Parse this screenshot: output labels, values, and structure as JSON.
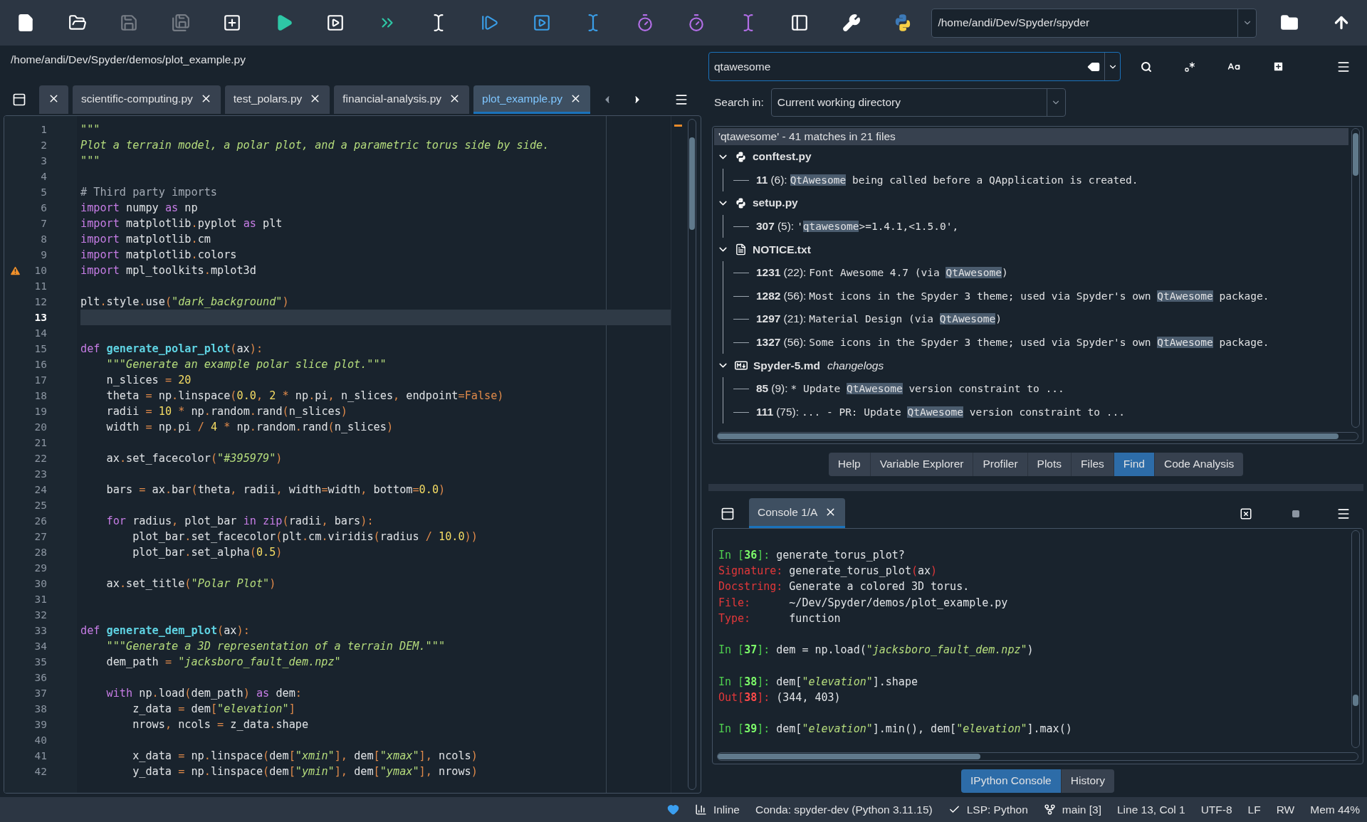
{
  "toolbar": [
    {
      "disabled": false
    },
    {
      "disabled": false
    },
    {
      "disabled": true
    },
    {
      "disabled": true
    },
    {
      "disabled": false
    },
    {
      "disabled": false
    },
    {
      "disabled": false
    },
    {
      "disabled": false
    },
    {
      "disabled": false
    },
    {
      "disabled": false
    },
    {
      "disabled": false
    },
    {
      "disabled": false
    },
    {
      "disabled": false
    },
    {
      "disabled": false
    },
    {
      "disabled": false
    },
    {
      "disabled": false
    },
    {
      "disabled": false
    },
    {
      "disabled": false
    }
  ],
  "working_directory": "/home/andi/Dev/Spyder/spyder",
  "editor": {
    "path": "/home/andi/Dev/Spyder/demos/plot_example.py",
    "tabs": [
      {
        "selected": false
      },
      {
        "label": "scientific-computing.py",
        "selected": false
      },
      {
        "label": "test_polars.py",
        "selected": false
      },
      {
        "label": "financial-analysis.py",
        "selected": false
      },
      {
        "label": "plot_example.py",
        "selected": true
      }
    ],
    "lines": [
      {
        "n": "1",
        "current": false,
        "warning": false,
        "tokens": [
          {
            "kind": "string",
            "text": "\"\"\""
          }
        ]
      },
      {
        "n": "2",
        "current": false,
        "warning": false,
        "tokens": [
          {
            "kind": "string",
            "text": "Plot a terrain model, a polar plot, and a parametric torus side by side."
          }
        ]
      },
      {
        "n": "3",
        "current": false,
        "warning": false,
        "tokens": [
          {
            "kind": "string",
            "text": "\"\"\""
          }
        ]
      },
      {
        "n": "4",
        "current": false,
        "warning": false
      },
      {
        "n": "5",
        "current": false,
        "warning": false,
        "tokens": [
          {
            "kind": "comment",
            "text": "# Third party imports"
          }
        ]
      },
      {
        "n": "6",
        "current": false,
        "warning": false,
        "tokens": [
          {
            "kind": "keyword",
            "text": "import"
          },
          {
            "kind": "plain",
            "text": " numpy "
          },
          {
            "kind": "keyword",
            "text": "as"
          },
          {
            "kind": "plain",
            "text": " np"
          }
        ]
      },
      {
        "n": "7",
        "current": false,
        "warning": false,
        "tokens": [
          {
            "kind": "keyword",
            "text": "import"
          },
          {
            "kind": "plain",
            "text": " matplotlib"
          },
          {
            "kind": "operator",
            "text": "."
          },
          {
            "kind": "plain",
            "text": "pyplot "
          },
          {
            "kind": "keyword",
            "text": "as"
          },
          {
            "kind": "plain",
            "text": " plt"
          }
        ]
      },
      {
        "n": "8",
        "current": false,
        "warning": false,
        "tokens": [
          {
            "kind": "keyword",
            "text": "import"
          },
          {
            "kind": "plain",
            "text": " matplotlib"
          },
          {
            "kind": "operator",
            "text": "."
          },
          {
            "kind": "plain",
            "text": "cm"
          }
        ]
      },
      {
        "n": "9",
        "current": false,
        "warning": false,
        "tokens": [
          {
            "kind": "keyword",
            "text": "import"
          },
          {
            "kind": "plain",
            "text": " matplotlib"
          },
          {
            "kind": "operator",
            "text": "."
          },
          {
            "kind": "plain",
            "text": "colors"
          }
        ]
      },
      {
        "n": "10",
        "current": false,
        "warning": true,
        "tokens": [
          {
            "kind": "keyword",
            "text": "import"
          },
          {
            "kind": "plain",
            "text": " mpl_toolkits"
          },
          {
            "kind": "operator",
            "text": "."
          },
          {
            "kind": "plain",
            "text": "mplot3d"
          }
        ]
      },
      {
        "n": "11",
        "current": false,
        "warning": false
      },
      {
        "n": "12",
        "current": false,
        "warning": false,
        "tokens": [
          {
            "kind": "plain",
            "text": "plt"
          },
          {
            "kind": "operator",
            "text": "."
          },
          {
            "kind": "plain",
            "text": "style"
          },
          {
            "kind": "operator",
            "text": "."
          },
          {
            "kind": "plain",
            "text": "use"
          },
          {
            "kind": "operator",
            "text": "("
          },
          {
            "kind": "string",
            "text": "\"dark_background\""
          },
          {
            "kind": "operator",
            "text": ")"
          }
        ]
      },
      {
        "n": "13",
        "current": true,
        "warning": false
      },
      {
        "n": "14",
        "current": false,
        "warning": false
      },
      {
        "n": "15",
        "current": false,
        "warning": false,
        "tokens": [
          {
            "kind": "keyword",
            "text": "def "
          },
          {
            "kind": "function",
            "text": "generate_polar_plot"
          },
          {
            "kind": "operator",
            "text": "("
          },
          {
            "kind": "plain",
            "text": "ax"
          },
          {
            "kind": "operator",
            "text": "):"
          }
        ]
      },
      {
        "n": "16",
        "current": false,
        "warning": false,
        "tokens": [
          {
            "kind": "string",
            "text": "    \"\"\"Generate an example polar slice plot.\"\"\""
          }
        ]
      },
      {
        "n": "17",
        "current": false,
        "warning": false,
        "tokens": [
          {
            "kind": "plain",
            "text": "    n_slices "
          },
          {
            "kind": "operator",
            "text": "="
          },
          {
            "kind": "number",
            "text": " 20"
          }
        ]
      },
      {
        "n": "18",
        "current": false,
        "warning": false,
        "tokens": [
          {
            "kind": "plain",
            "text": "    theta "
          },
          {
            "kind": "operator",
            "text": "="
          },
          {
            "kind": "plain",
            "text": " np"
          },
          {
            "kind": "operator",
            "text": "."
          },
          {
            "kind": "plain",
            "text": "linspace"
          },
          {
            "kind": "operator",
            "text": "("
          },
          {
            "kind": "number",
            "text": "0.0"
          },
          {
            "kind": "operator",
            "text": ", "
          },
          {
            "kind": "number",
            "text": "2"
          },
          {
            "kind": "operator",
            "text": " * "
          },
          {
            "kind": "plain",
            "text": "np"
          },
          {
            "kind": "operator",
            "text": "."
          },
          {
            "kind": "plain",
            "text": "pi"
          },
          {
            "kind": "operator",
            "text": ", "
          },
          {
            "kind": "plain",
            "text": "n_slices"
          },
          {
            "kind": "operator",
            "text": ", "
          },
          {
            "kind": "plain",
            "text": "endpoint"
          },
          {
            "kind": "operator",
            "text": "=False)"
          }
        ]
      },
      {
        "n": "19",
        "current": false,
        "warning": false,
        "tokens": [
          {
            "kind": "plain",
            "text": "    radii "
          },
          {
            "kind": "operator",
            "text": "="
          },
          {
            "kind": "number",
            "text": " 10"
          },
          {
            "kind": "operator",
            "text": " * "
          },
          {
            "kind": "plain",
            "text": "np"
          },
          {
            "kind": "operator",
            "text": "."
          },
          {
            "kind": "plain",
            "text": "random"
          },
          {
            "kind": "operator",
            "text": "."
          },
          {
            "kind": "plain",
            "text": "rand"
          },
          {
            "kind": "operator",
            "text": "("
          },
          {
            "kind": "plain",
            "text": "n_slices"
          },
          {
            "kind": "operator",
            "text": ")"
          }
        ]
      },
      {
        "n": "20",
        "current": false,
        "warning": false,
        "tokens": [
          {
            "kind": "plain",
            "text": "    width "
          },
          {
            "kind": "operator",
            "text": "="
          },
          {
            "kind": "plain",
            "text": " np"
          },
          {
            "kind": "operator",
            "text": "."
          },
          {
            "kind": "plain",
            "text": "pi"
          },
          {
            "kind": "operator",
            "text": " / "
          },
          {
            "kind": "number",
            "text": "4"
          },
          {
            "kind": "operator",
            "text": " * "
          },
          {
            "kind": "plain",
            "text": "np"
          },
          {
            "kind": "operator",
            "text": "."
          },
          {
            "kind": "plain",
            "text": "random"
          },
          {
            "kind": "operator",
            "text": "."
          },
          {
            "kind": "plain",
            "text": "rand"
          },
          {
            "kind": "operator",
            "text": "("
          },
          {
            "kind": "plain",
            "text": "n_slices"
          },
          {
            "kind": "operator",
            "text": ")"
          }
        ]
      },
      {
        "n": "21",
        "current": false,
        "warning": false
      },
      {
        "n": "22",
        "current": false,
        "warning": false,
        "tokens": [
          {
            "kind": "plain",
            "text": "    ax"
          },
          {
            "kind": "operator",
            "text": "."
          },
          {
            "kind": "plain",
            "text": "set_facecolor"
          },
          {
            "kind": "operator",
            "text": "("
          },
          {
            "kind": "string",
            "text": "\"#395979\""
          },
          {
            "kind": "operator",
            "text": ")"
          }
        ]
      },
      {
        "n": "23",
        "current": false,
        "warning": false
      },
      {
        "n": "24",
        "current": false,
        "warning": false,
        "tokens": [
          {
            "kind": "plain",
            "text": "    bars "
          },
          {
            "kind": "operator",
            "text": "="
          },
          {
            "kind": "plain",
            "text": " ax"
          },
          {
            "kind": "operator",
            "text": "."
          },
          {
            "kind": "plain",
            "text": "bar"
          },
          {
            "kind": "operator",
            "text": "("
          },
          {
            "kind": "plain",
            "text": "theta"
          },
          {
            "kind": "operator",
            "text": ", "
          },
          {
            "kind": "plain",
            "text": "radii"
          },
          {
            "kind": "operator",
            "text": ", "
          },
          {
            "kind": "plain",
            "text": "width"
          },
          {
            "kind": "operator",
            "text": "="
          },
          {
            "kind": "plain",
            "text": "width"
          },
          {
            "kind": "operator",
            "text": ", "
          },
          {
            "kind": "plain",
            "text": "bottom"
          },
          {
            "kind": "operator",
            "text": "="
          },
          {
            "kind": "number",
            "text": "0.0"
          },
          {
            "kind": "operator",
            "text": ")"
          }
        ]
      },
      {
        "n": "25",
        "current": false,
        "warning": false
      },
      {
        "n": "26",
        "current": false,
        "warning": false,
        "tokens": [
          {
            "kind": "keyword",
            "text": "    for"
          },
          {
            "kind": "plain",
            "text": " radius"
          },
          {
            "kind": "operator",
            "text": ", "
          },
          {
            "kind": "plain",
            "text": "plot_bar "
          },
          {
            "kind": "keyword",
            "text": "in zip"
          },
          {
            "kind": "operator",
            "text": "("
          },
          {
            "kind": "plain",
            "text": "radii"
          },
          {
            "kind": "operator",
            "text": ", "
          },
          {
            "kind": "plain",
            "text": "bars"
          },
          {
            "kind": "operator",
            "text": "):"
          }
        ]
      },
      {
        "n": "27",
        "current": false,
        "warning": false,
        "tokens": [
          {
            "kind": "plain",
            "text": "        plot_bar"
          },
          {
            "kind": "operator",
            "text": "."
          },
          {
            "kind": "plain",
            "text": "set_facecolor"
          },
          {
            "kind": "operator",
            "text": "("
          },
          {
            "kind": "plain",
            "text": "plt"
          },
          {
            "kind": "operator",
            "text": "."
          },
          {
            "kind": "plain",
            "text": "cm"
          },
          {
            "kind": "operator",
            "text": "."
          },
          {
            "kind": "plain",
            "text": "viridis"
          },
          {
            "kind": "operator",
            "text": "("
          },
          {
            "kind": "plain",
            "text": "radius "
          },
          {
            "kind": "operator",
            "text": "/"
          },
          {
            "kind": "number",
            "text": " 10.0"
          },
          {
            "kind": "operator",
            "text": "))"
          }
        ]
      },
      {
        "n": "28",
        "current": false,
        "warning": false,
        "tokens": [
          {
            "kind": "plain",
            "text": "        plot_bar"
          },
          {
            "kind": "operator",
            "text": "."
          },
          {
            "kind": "plain",
            "text": "set_alpha"
          },
          {
            "kind": "operator",
            "text": "("
          },
          {
            "kind": "number",
            "text": "0.5"
          },
          {
            "kind": "operator",
            "text": ")"
          }
        ]
      },
      {
        "n": "29",
        "current": false,
        "warning": false
      },
      {
        "n": "30",
        "current": false,
        "warning": false,
        "tokens": [
          {
            "kind": "plain",
            "text": "    ax"
          },
          {
            "kind": "operator",
            "text": "."
          },
          {
            "kind": "plain",
            "text": "set_title"
          },
          {
            "kind": "operator",
            "text": "("
          },
          {
            "kind": "string",
            "text": "\"Polar Plot\""
          },
          {
            "kind": "operator",
            "text": ")"
          }
        ]
      },
      {
        "n": "31",
        "current": false,
        "warning": false
      },
      {
        "n": "32",
        "current": false,
        "warning": false
      },
      {
        "n": "33",
        "current": false,
        "warning": false,
        "tokens": [
          {
            "kind": "keyword",
            "text": "def "
          },
          {
            "kind": "function",
            "text": "generate_dem_plot"
          },
          {
            "kind": "operator",
            "text": "("
          },
          {
            "kind": "plain",
            "text": "ax"
          },
          {
            "kind": "operator",
            "text": "):"
          }
        ]
      },
      {
        "n": "34",
        "current": false,
        "warning": false,
        "tokens": [
          {
            "kind": "string",
            "text": "    \"\"\"Generate a 3D representation of a terrain DEM.\"\"\""
          }
        ]
      },
      {
        "n": "35",
        "current": false,
        "warning": false,
        "tokens": [
          {
            "kind": "plain",
            "text": "    dem_path "
          },
          {
            "kind": "operator",
            "text": "="
          },
          {
            "kind": "string",
            "text": " \"jacksboro_fault_dem.npz\""
          }
        ]
      },
      {
        "n": "36",
        "current": false,
        "warning": false
      },
      {
        "n": "37",
        "current": false,
        "warning": false,
        "tokens": [
          {
            "kind": "keyword",
            "text": "    with"
          },
          {
            "kind": "plain",
            "text": " np"
          },
          {
            "kind": "operator",
            "text": "."
          },
          {
            "kind": "plain",
            "text": "load"
          },
          {
            "kind": "operator",
            "text": "("
          },
          {
            "kind": "plain",
            "text": "dem_path"
          },
          {
            "kind": "operator",
            "text": ")"
          },
          {
            "kind": "keyword",
            "text": " as"
          },
          {
            "kind": "plain",
            "text": " dem"
          },
          {
            "kind": "operator",
            "text": ":"
          }
        ]
      },
      {
        "n": "38",
        "current": false,
        "warning": false,
        "tokens": [
          {
            "kind": "plain",
            "text": "        z_data "
          },
          {
            "kind": "operator",
            "text": "="
          },
          {
            "kind": "plain",
            "text": " dem"
          },
          {
            "kind": "operator",
            "text": "["
          },
          {
            "kind": "string",
            "text": "\"elevation\""
          },
          {
            "kind": "operator",
            "text": "]"
          }
        ]
      },
      {
        "n": "39",
        "current": false,
        "warning": false,
        "tokens": [
          {
            "kind": "plain",
            "text": "        nrows"
          },
          {
            "kind": "operator",
            "text": ", "
          },
          {
            "kind": "plain",
            "text": "ncols "
          },
          {
            "kind": "operator",
            "text": "="
          },
          {
            "kind": "plain",
            "text": " z_data"
          },
          {
            "kind": "operator",
            "text": "."
          },
          {
            "kind": "plain",
            "text": "shape"
          }
        ]
      },
      {
        "n": "40",
        "current": false,
        "warning": false
      },
      {
        "n": "41",
        "current": false,
        "warning": false,
        "tokens": [
          {
            "kind": "plain",
            "text": "        x_data "
          },
          {
            "kind": "operator",
            "text": "="
          },
          {
            "kind": "plain",
            "text": " np"
          },
          {
            "kind": "operator",
            "text": "."
          },
          {
            "kind": "plain",
            "text": "linspace"
          },
          {
            "kind": "operator",
            "text": "("
          },
          {
            "kind": "plain",
            "text": "dem"
          },
          {
            "kind": "operator",
            "text": "["
          },
          {
            "kind": "string",
            "text": "\"xmin\""
          },
          {
            "kind": "operator",
            "text": "], "
          },
          {
            "kind": "plain",
            "text": "dem"
          },
          {
            "kind": "operator",
            "text": "["
          },
          {
            "kind": "string",
            "text": "\"xmax\""
          },
          {
            "kind": "operator",
            "text": "], "
          },
          {
            "kind": "plain",
            "text": "ncols"
          },
          {
            "kind": "operator",
            "text": ")"
          }
        ]
      },
      {
        "n": "42",
        "current": false,
        "warning": false,
        "tokens": [
          {
            "kind": "plain",
            "text": "        y_data "
          },
          {
            "kind": "operator",
            "text": "="
          },
          {
            "kind": "plain",
            "text": " np"
          },
          {
            "kind": "operator",
            "text": "."
          },
          {
            "kind": "plain",
            "text": "linspace"
          },
          {
            "kind": "operator",
            "text": "("
          },
          {
            "kind": "plain",
            "text": "dem"
          },
          {
            "kind": "operator",
            "text": "["
          },
          {
            "kind": "string",
            "text": "\"ymin\""
          },
          {
            "kind": "operator",
            "text": "], "
          },
          {
            "kind": "plain",
            "text": "dem"
          },
          {
            "kind": "operator",
            "text": "["
          },
          {
            "kind": "string",
            "text": "\"ymax\""
          },
          {
            "kind": "operator",
            "text": "], "
          },
          {
            "kind": "plain",
            "text": "nrows"
          },
          {
            "kind": "operator",
            "text": ")"
          }
        ]
      }
    ]
  },
  "find": {
    "query": "qtawesome",
    "search_in_label": "Search in:",
    "search_in": "Current working directory",
    "summary": "'qtawesome' - 41 matches in 21 files",
    "files": [
      {
        "name": "conftest.py",
        "kind": "python",
        "expanded": true,
        "results": [
          {
            "line": "11",
            "col": "(6):",
            "match": "QtAwesome",
            "after": " being called before a QApplication is created."
          }
        ]
      },
      {
        "name": "setup.py",
        "kind": "python",
        "expanded": true,
        "results": [
          {
            "line": "307",
            "col": "(5):",
            "before": "'",
            "match": "qtawesome",
            "after": ">=1.4.1,<1.5.0',"
          }
        ]
      },
      {
        "name": "NOTICE.txt",
        "kind": "text",
        "expanded": true,
        "results": [
          {
            "line": "1231",
            "col": "(22):",
            "before": "Font Awesome 4.7 (via ",
            "match": "QtAwesome",
            "after": ")"
          },
          {
            "line": "1282",
            "col": "(56):",
            "before": "Most icons in the Spyder 3 theme; used via Spyder's own ",
            "match": "QtAwesome",
            "after": " package."
          },
          {
            "line": "1297",
            "col": "(21):",
            "before": "Material Design (via ",
            "match": "QtAwesome",
            "after": ")"
          },
          {
            "line": "1327",
            "col": "(56):",
            "before": "Some icons in the Spyder 3 theme; used via Spyder's own ",
            "match": "QtAwesome",
            "after": " package."
          }
        ]
      },
      {
        "name": "Spyder-5.md",
        "kind": "markdown",
        "note": "changelogs",
        "expanded": true,
        "results": [
          {
            "line": "85",
            "col": "(9):",
            "before": "* Update ",
            "match": "QtAwesome",
            "after": " version constraint to ..."
          },
          {
            "line": "111",
            "col": "(75):",
            "before": "... - PR: Update ",
            "match": "QtAwesome",
            "after": " version constraint to ..."
          }
        ]
      }
    ]
  },
  "plugin_tabs": [
    {
      "label": "Help",
      "selected": false
    },
    {
      "label": "Variable Explorer",
      "selected": false
    },
    {
      "label": "Profiler",
      "selected": false
    },
    {
      "label": "Plots",
      "selected": false
    },
    {
      "label": "Files",
      "selected": false
    },
    {
      "label": "Find",
      "selected": true
    },
    {
      "label": "Code Analysis",
      "selected": false
    }
  ],
  "console": {
    "tabs": [
      {
        "label": "Console 1/A",
        "selected": true
      }
    ],
    "blocks": [
      [
        [
          {
            "kind": "prompt",
            "text": "In ["
          },
          {
            "kind": "prompt_number",
            "text": "36"
          },
          {
            "kind": "prompt",
            "text": "]: "
          },
          {
            "kind": "plain",
            "text": "generate_torus_plot?"
          }
        ],
        [
          {
            "kind": "label",
            "text": "Signature: "
          },
          {
            "kind": "plain",
            "text": "generate_torus_plot"
          },
          {
            "kind": "label",
            "text": "("
          },
          {
            "kind": "plain",
            "text": "ax"
          },
          {
            "kind": "label",
            "text": ")"
          }
        ],
        [
          {
            "kind": "label",
            "text": "Docstring: "
          },
          {
            "kind": "plain",
            "text": "Generate a colored 3D torus."
          }
        ],
        [
          {
            "kind": "label",
            "text": "File:      "
          },
          {
            "kind": "plain",
            "text": "~/Dev/Spyder/demos/plot_example.py"
          }
        ],
        [
          {
            "kind": "label",
            "text": "Type:      "
          },
          {
            "kind": "plain",
            "text": "function"
          }
        ]
      ],
      [
        [
          {
            "kind": "prompt",
            "text": "In ["
          },
          {
            "kind": "prompt_number",
            "text": "37"
          },
          {
            "kind": "prompt",
            "text": "]: "
          },
          {
            "kind": "plain",
            "text": "dem = np.load("
          },
          {
            "kind": "string",
            "text": "\"jacksboro_fault_dem.npz\""
          },
          {
            "kind": "plain",
            "text": ")"
          }
        ]
      ],
      [
        [
          {
            "kind": "prompt",
            "text": "In ["
          },
          {
            "kind": "prompt_number",
            "text": "38"
          },
          {
            "kind": "prompt",
            "text": "]: "
          },
          {
            "kind": "plain",
            "text": "dem["
          },
          {
            "kind": "string",
            "text": "\"elevation\""
          },
          {
            "kind": "plain",
            "text": "].shape"
          }
        ],
        [
          {
            "kind": "label",
            "text": "Out["
          },
          {
            "kind": "output_number",
            "text": "38"
          },
          {
            "kind": "label",
            "text": "]: "
          },
          {
            "kind": "plain",
            "text": "(344, 403)"
          }
        ]
      ],
      [
        [
          {
            "kind": "prompt",
            "text": "In ["
          },
          {
            "kind": "prompt_number",
            "text": "39"
          },
          {
            "kind": "prompt",
            "text": "]: "
          },
          {
            "kind": "plain",
            "text": "dem["
          },
          {
            "kind": "string",
            "text": "\"elevation\""
          },
          {
            "kind": "plain",
            "text": "].min(), dem["
          },
          {
            "kind": "string",
            "text": "\"elevation\""
          },
          {
            "kind": "plain",
            "text": "].max()"
          }
        ]
      ]
    ]
  },
  "console_tabs": [
    {
      "label": "IPython Console",
      "selected": true
    },
    {
      "label": "History",
      "selected": false
    }
  ],
  "status_bar": [
    {
      "kind": "heart"
    },
    {
      "kind": "plots",
      "text": "Inline"
    },
    {
      "kind": "env",
      "text": "Conda: spyder-dev (Python 3.11.15)"
    },
    {
      "kind": "lsp",
      "text": "LSP: Python"
    },
    {
      "kind": "vcs",
      "text": "main [3]"
    },
    {
      "kind": "cursor",
      "text": "Line 13, Col 1"
    },
    {
      "kind": "encoding",
      "text": "UTF-8"
    },
    {
      "kind": "eol",
      "text": "LF"
    },
    {
      "kind": "permissions",
      "text": "RW"
    },
    {
      "kind": "memory",
      "text": "Mem 44%"
    }
  ]
}
